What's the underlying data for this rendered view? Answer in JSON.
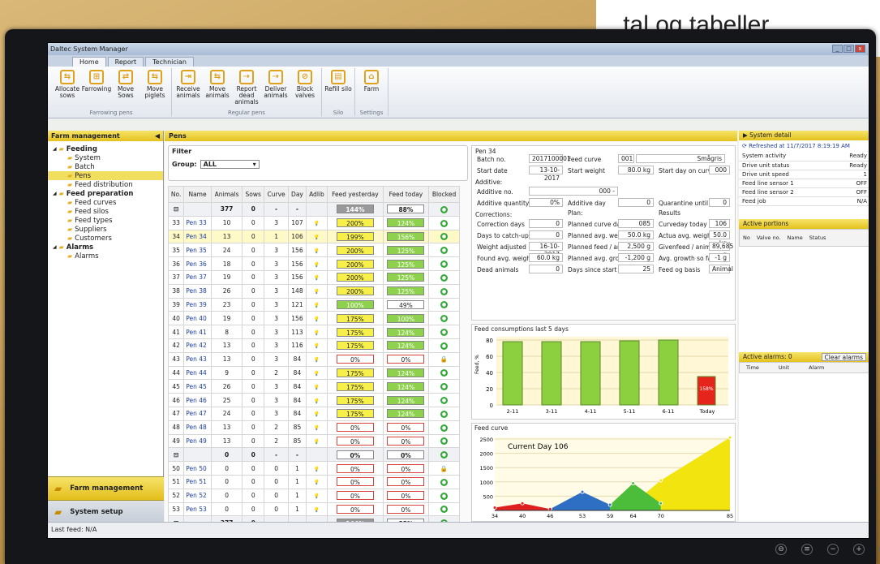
{
  "tagline": "tal og tabeller.",
  "window": {
    "title": "Daltec System Manager"
  },
  "tabs": [
    "Home",
    "Report",
    "Technician"
  ],
  "ribbon": {
    "groups": [
      {
        "label": "Farrowing pens",
        "buttons": [
          "Allocate sows",
          "Farrowing",
          "Move Sows",
          "Move piglets"
        ]
      },
      {
        "label": "Regular pens",
        "buttons": [
          "Receive animals",
          "Move animals",
          "Report dead animals",
          "Deliver animals",
          "Block valves"
        ]
      },
      {
        "label": "Silo",
        "buttons": [
          "Refill silo"
        ]
      },
      {
        "label": "Settings",
        "buttons": [
          "Farm"
        ]
      }
    ]
  },
  "logo": "daltec",
  "left": {
    "title": "Farm management",
    "tree": [
      {
        "label": "Feeding",
        "level": 0,
        "bold": true
      },
      {
        "label": "System",
        "level": 1
      },
      {
        "label": "Batch",
        "level": 1
      },
      {
        "label": "Pens",
        "level": 1,
        "selected": true
      },
      {
        "label": "Feed distribution",
        "level": 1
      },
      {
        "label": "Feed preparation",
        "level": 0,
        "bold": true
      },
      {
        "label": "Feed curves",
        "level": 1
      },
      {
        "label": "Feed silos",
        "level": 1
      },
      {
        "label": "Feed types",
        "level": 1
      },
      {
        "label": "Suppliers",
        "level": 1
      },
      {
        "label": "Customers",
        "level": 1
      },
      {
        "label": "Alarms",
        "level": 0,
        "bold": true
      },
      {
        "label": "Alarms",
        "level": 1
      }
    ],
    "nav": [
      "Farm management",
      "System setup"
    ]
  },
  "main": {
    "title": "Pens",
    "filter": {
      "label": "Filter",
      "group_label": "Group:",
      "group_value": "ALL"
    }
  },
  "table": {
    "headers": [
      "No.",
      "Name",
      "Animals",
      "Sows",
      "Curve",
      "Day",
      "Adlib",
      "Feed yesterday",
      "Feed today",
      "Blocked"
    ],
    "rows": [
      [
        "⊟",
        "",
        "377",
        "0",
        "-",
        "-",
        "",
        "144%",
        "88%",
        "●"
      ],
      [
        "33",
        "Pen 33",
        "10",
        "0",
        "3",
        "107",
        "💡",
        "200%",
        "124%",
        "●"
      ],
      [
        "34",
        "Pen 34",
        "13",
        "0",
        "1",
        "106",
        "💡",
        "199%",
        "156%",
        "●"
      ],
      [
        "35",
        "Pen 35",
        "24",
        "0",
        "3",
        "156",
        "💡",
        "200%",
        "125%",
        "●"
      ],
      [
        "36",
        "Pen 36",
        "18",
        "0",
        "3",
        "156",
        "💡",
        "200%",
        "125%",
        "●"
      ],
      [
        "37",
        "Pen 37",
        "19",
        "0",
        "3",
        "156",
        "💡",
        "200%",
        "125%",
        "●"
      ],
      [
        "38",
        "Pen 38",
        "26",
        "0",
        "3",
        "148",
        "💡",
        "200%",
        "125%",
        "●"
      ],
      [
        "39",
        "Pen 39",
        "23",
        "0",
        "3",
        "121",
        "💡",
        "100%",
        "49%",
        "●"
      ],
      [
        "40",
        "Pen 40",
        "19",
        "0",
        "3",
        "156",
        "💡",
        "175%",
        "100%",
        "●"
      ],
      [
        "41",
        "Pen 41",
        "8",
        "0",
        "3",
        "113",
        "💡",
        "175%",
        "124%",
        "●"
      ],
      [
        "42",
        "Pen 42",
        "13",
        "0",
        "3",
        "116",
        "💡",
        "175%",
        "124%",
        "●"
      ],
      [
        "43",
        "Pen 43",
        "13",
        "0",
        "3",
        "84",
        "💡",
        "0%",
        "0%",
        "🔒"
      ],
      [
        "44",
        "Pen 44",
        "9",
        "0",
        "2",
        "84",
        "💡",
        "175%",
        "124%",
        "●"
      ],
      [
        "45",
        "Pen 45",
        "26",
        "0",
        "3",
        "84",
        "💡",
        "175%",
        "124%",
        "●"
      ],
      [
        "46",
        "Pen 46",
        "25",
        "0",
        "3",
        "84",
        "💡",
        "175%",
        "124%",
        "●"
      ],
      [
        "47",
        "Pen 47",
        "24",
        "0",
        "3",
        "84",
        "💡",
        "175%",
        "124%",
        "●"
      ],
      [
        "48",
        "Pen 48",
        "13",
        "0",
        "2",
        "85",
        "💡",
        "0%",
        "0%",
        "●"
      ],
      [
        "49",
        "Pen 49",
        "13",
        "0",
        "2",
        "85",
        "💡",
        "0%",
        "0%",
        "●"
      ],
      [
        "⊟",
        "",
        "0",
        "0",
        "-",
        "-",
        "",
        "0%",
        "0%",
        "●"
      ],
      [
        "50",
        "Pen 50",
        "0",
        "0",
        "0",
        "1",
        "💡",
        "0%",
        "0%",
        "🔒"
      ],
      [
        "51",
        "Pen 51",
        "0",
        "0",
        "0",
        "1",
        "💡",
        "0%",
        "0%",
        "●"
      ],
      [
        "52",
        "Pen 52",
        "0",
        "0",
        "0",
        "1",
        "💡",
        "0%",
        "0%",
        "●"
      ],
      [
        "53",
        "Pen 53",
        "0",
        "0",
        "0",
        "1",
        "💡",
        "0%",
        "0%",
        "●"
      ],
      [
        "⊟",
        "",
        "377",
        "0",
        "-",
        "-",
        "",
        "144%",
        "88%",
        "●"
      ]
    ]
  },
  "pen": {
    "title": "Pen 34",
    "batch_label": "Batch no.",
    "batch": "2017100001",
    "curve_label": "Feed curve",
    "curve_no": "001",
    "curve_name": "Smågris",
    "start_label": "Start date",
    "start": "13-10-2017",
    "startw_label": "Start weight",
    "startw": "80.0 kg",
    "startday_label": "Start day on curve",
    "startday": "000",
    "additive_head": "Additive:",
    "addno_label": "Additive no.",
    "addno": "000 -",
    "addq_label": "Additive quantity",
    "addq": "0%",
    "addday_label": "Additive day",
    "addday": "0",
    "quar_label": "Quarantine until",
    "quar": "0",
    "corr_head": "Corrections:",
    "plan_head": "Plan:",
    "res_head": "Results",
    "corr": [
      [
        "Correction days",
        "0"
      ],
      [
        "Days to catch-up",
        "0"
      ],
      [
        "Weight adjusted",
        "16-10-2017"
      ],
      [
        "Found avg. weight",
        "60.0 kg"
      ],
      [
        "Dead animals",
        "0"
      ]
    ],
    "plan": [
      [
        "Planned curve day",
        "085"
      ],
      [
        "Planned avg. weight",
        "50.0 kg"
      ],
      [
        "Planned feed / animal",
        "2,500 g"
      ],
      [
        "Planned avg. growth",
        "-1,200 g"
      ],
      [
        "Days since start",
        "25"
      ]
    ],
    "res": [
      [
        "Curveday today",
        "106"
      ],
      [
        "Actua avg. weight",
        "50.0 kg"
      ],
      [
        "Givenfeed / animal",
        "89,685 g"
      ],
      [
        "Avg. growth so far",
        "-1 g"
      ],
      [
        "Feed og basis",
        "Animal"
      ]
    ]
  },
  "chart_data": [
    {
      "type": "bar",
      "title": "Feed consumptions last 5 days",
      "ylabel": "Feed, %",
      "categories": [
        "2-11",
        "3-11",
        "4-11",
        "5-11",
        "6-11",
        "Today"
      ],
      "values": [
        78,
        78,
        78,
        79,
        80,
        35
      ],
      "ylim": [
        0,
        80
      ],
      "data_label": "158%",
      "colors": {
        "bar": "#8ccf3f",
        "today": "#e5251b"
      }
    },
    {
      "type": "area",
      "title": "Feed curve",
      "annotation": "Current Day 106",
      "x_ticks": [
        34,
        40,
        46,
        53,
        59,
        64,
        70,
        85
      ],
      "y_ticks": [
        500,
        1000,
        1500,
        2000,
        2500
      ],
      "ylim": [
        0,
        2500
      ],
      "xlim": [
        34,
        85
      ],
      "series": [
        {
          "color": "#e02020",
          "x": [
            34,
            40,
            46
          ],
          "y": [
            100,
            250,
            50
          ]
        },
        {
          "color": "#2e6fc4",
          "x": [
            46,
            53,
            59
          ],
          "y": [
            50,
            650,
            200
          ]
        },
        {
          "color": "#4bbd3a",
          "x": [
            59,
            64,
            70
          ],
          "y": [
            200,
            950,
            250
          ]
        },
        {
          "color": "#f2e40e",
          "x": [
            64,
            70,
            85
          ],
          "y": [
            250,
            1050,
            2550
          ]
        }
      ]
    }
  ],
  "right": {
    "title": "System detail",
    "refreshed": "Refreshed at 11/7/2017 8:19:19 AM",
    "details": [
      [
        "System activity",
        "Ready"
      ],
      [
        "Drive unit status",
        "Ready"
      ],
      [
        "Drive unit speed",
        "1"
      ],
      [
        "Feed line sensor 1",
        "OFF"
      ],
      [
        "Feed line sensor 2",
        "OFF"
      ],
      [
        "Feed job",
        "N/A"
      ]
    ],
    "portions_title": "Active portions",
    "portions_cols": [
      "No",
      "Valve no.",
      "Name",
      "Status"
    ],
    "alarms_title": "Active alarms: 0",
    "clear": "Clear alarms",
    "alarm_cols": [
      "Time",
      "Unit",
      "Alarm"
    ]
  },
  "status": {
    "last_feed": "Last feed:  N/A"
  }
}
